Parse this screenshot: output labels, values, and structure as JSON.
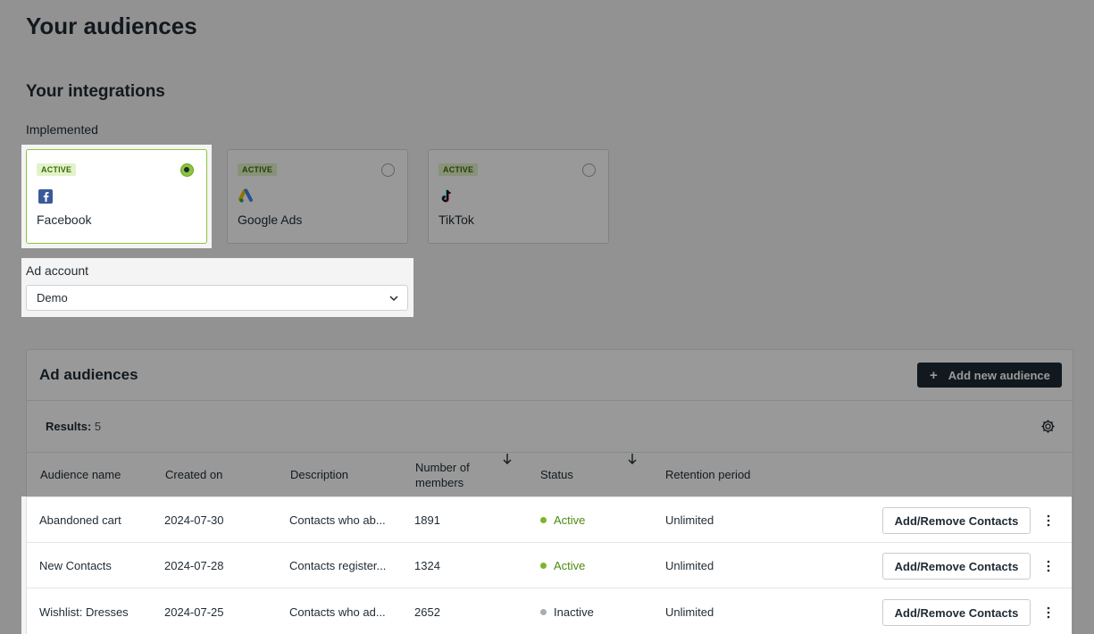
{
  "page": {
    "title": "Your audiences"
  },
  "integrations": {
    "title": "Your integrations",
    "implemented_label": "Implemented",
    "cards": [
      {
        "badge": "ACTIVE",
        "name": "Facebook",
        "selected": true,
        "icon": "facebook-logo-icon"
      },
      {
        "badge": "ACTIVE",
        "name": "Google Ads",
        "selected": false,
        "icon": "google-ads-logo-icon"
      },
      {
        "badge": "ACTIVE",
        "name": "TikTok",
        "selected": false,
        "icon": "tiktok-logo-icon"
      }
    ]
  },
  "ad_account": {
    "label": "Ad account",
    "value": "Demo"
  },
  "audiences": {
    "title": "Ad audiences",
    "add_button": {
      "icon": "plus-icon",
      "label": "Add new audience"
    },
    "results_label": "Results:",
    "results_count": "5",
    "columns": {
      "name": "Audience name",
      "created": "Created on",
      "description": "Description",
      "members_line1": "Number of",
      "members_line2": "members",
      "status": "Status",
      "retention": "Retention period"
    },
    "rows": [
      {
        "name": "Abandoned cart",
        "created": "2024-07-30",
        "description": "Contacts who ab...",
        "members": "1891",
        "status": "Active",
        "retention": "Unlimited",
        "action": "Add/Remove Contacts"
      },
      {
        "name": "New Contacts",
        "created": "2024-07-28",
        "description": "Contacts register...",
        "members": "1324",
        "status": "Active",
        "retention": "Unlimited",
        "action": "Add/Remove Contacts"
      },
      {
        "name": "Wishlist: Dresses",
        "created": "2024-07-25",
        "description": "Contacts who ad...",
        "members": "2652",
        "status": "Inactive",
        "retention": "Unlimited",
        "action": "Add/Remove Contacts"
      }
    ]
  },
  "colors": {
    "accent_green": "#8cc43f",
    "dark_button": "#1f2a33",
    "inactive_dot": "#a6adb4"
  }
}
